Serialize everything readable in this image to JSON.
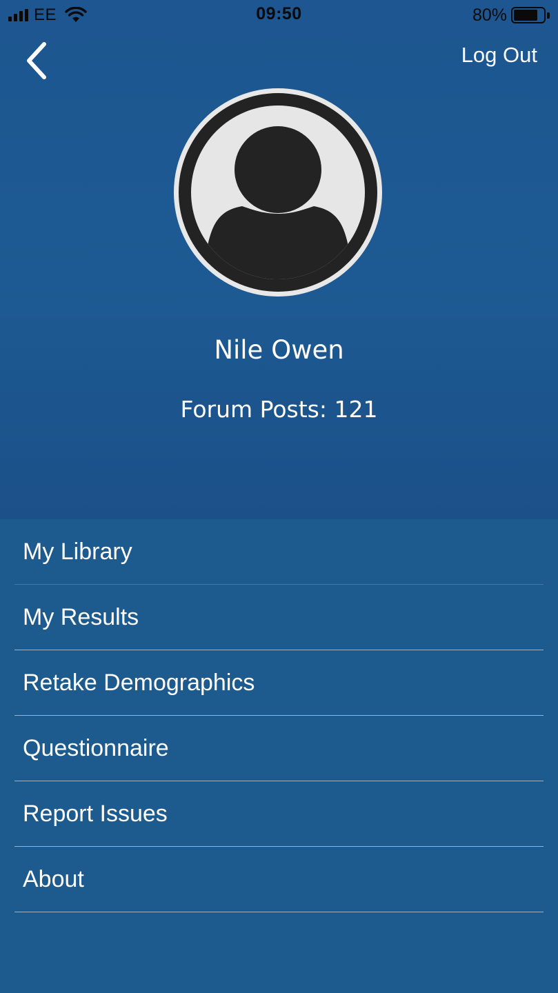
{
  "status_bar": {
    "carrier": "EE",
    "time": "09:50",
    "battery_percent_label": "80%",
    "battery_level": 0.8,
    "signal_bars": 4
  },
  "nav": {
    "back_icon": "chevron-left-icon",
    "logout_label": "Log Out"
  },
  "profile": {
    "avatar_icon": "user-avatar-icon",
    "name": "Nile Owen",
    "forum_posts_label": "Forum Posts: 121"
  },
  "menu": {
    "items": [
      {
        "label": "My Library"
      },
      {
        "label": "My Results"
      },
      {
        "label": "Retake Demographics"
      },
      {
        "label": "Questionnaire"
      },
      {
        "label": "Report Issues"
      },
      {
        "label": "About"
      }
    ]
  },
  "colors": {
    "background": "#1d5a8e",
    "text": "#ffffff",
    "status_text": "#0a0a0a",
    "avatar_ring": "#e8e8e8",
    "avatar_dark": "#232323"
  }
}
